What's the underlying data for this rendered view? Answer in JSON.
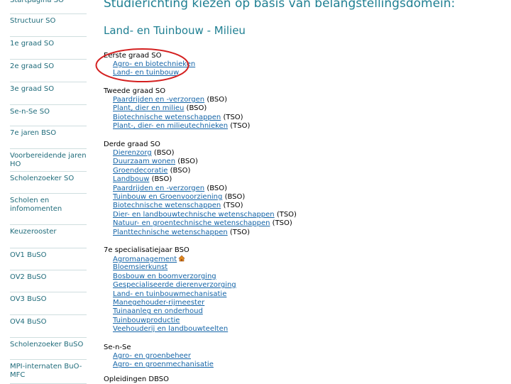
{
  "sidebar": {
    "items": [
      {
        "label": "Startpagina SO"
      },
      {
        "label": "Structuur SO"
      },
      {
        "label": "1e graad SO"
      },
      {
        "label": "2e graad SO"
      },
      {
        "label": "3e graad SO"
      },
      {
        "label": "Se-n-Se SO"
      },
      {
        "label": "7e jaren BSO"
      },
      {
        "label": "Voorbereidende jaren HO"
      },
      {
        "label": "Scholenzoeker SO"
      },
      {
        "label": "Scholen en infomomenten"
      },
      {
        "label": "Keuzerooster"
      },
      {
        "label": "OV1 BuSO"
      },
      {
        "label": "OV2 BuSO"
      },
      {
        "label": "OV3 BuSO"
      },
      {
        "label": "OV4 BuSO"
      },
      {
        "label": "Scholenzoeker BuSO"
      },
      {
        "label": "MPI-internaten BuO-MFC"
      }
    ]
  },
  "main": {
    "page_title": "Studierichting kiezen op basis van belangstellingsdomein:",
    "domain_title": "Land- en Tuinbouw - Milieu",
    "groups": [
      {
        "heading": "Eerste graad SO",
        "links": [
          {
            "label": "Agro- en biotechnieken",
            "suffix": ""
          },
          {
            "label": "Land- en tuinbouw",
            "suffix": ""
          }
        ]
      },
      {
        "heading": "Tweede graad SO",
        "links": [
          {
            "label": "Paardrijden en -verzorgen",
            "suffix": "(BSO)"
          },
          {
            "label": "Plant, dier en milieu",
            "suffix": "(BSO)"
          },
          {
            "label": "Biotechnische wetenschappen",
            "suffix": "(TSO)"
          },
          {
            "label": "Plant-, dier- en milieutechnieken",
            "suffix": "(TSO)"
          }
        ]
      },
      {
        "heading": "Derde graad SO",
        "links": [
          {
            "label": "Dierenzorg",
            "suffix": "(BSO)"
          },
          {
            "label": "Duurzaam wonen",
            "suffix": "(BSO)"
          },
          {
            "label": "Groendecoratie",
            "suffix": "(BSO)"
          },
          {
            "label": "Landbouw",
            "suffix": "(BSO)"
          },
          {
            "label": "Paardrijden en -verzorgen",
            "suffix": "(BSO)"
          },
          {
            "label": "Tuinbouw en Groenvoorziening",
            "suffix": "(BSO)"
          },
          {
            "label": "Biotechnische wetenschappen",
            "suffix": "(TSO)"
          },
          {
            "label": "Dier- en landbouwtechnische wetenschappen",
            "suffix": "(TSO)"
          },
          {
            "label": "Natuur- en groentechnische wetenschappen",
            "suffix": "(TSO)"
          },
          {
            "label": "Planttechnische wetenschappen",
            "suffix": "(TSO)"
          }
        ]
      },
      {
        "heading": "7e specialisatiejaar BSO",
        "links": [
          {
            "label": "Agromanagement",
            "suffix": "",
            "icon": "house-icon"
          },
          {
            "label": "Bloemsierkunst",
            "suffix": ""
          },
          {
            "label": "Bosbouw en boomverzorging",
            "suffix": ""
          },
          {
            "label": "Gespecialiseerde dierenverzorging",
            "suffix": ""
          },
          {
            "label": "Land- en tuinbouwmechanisatie",
            "suffix": ""
          },
          {
            "label": "Manegehouder-rijmeester",
            "suffix": ""
          },
          {
            "label": "Tuinaanleg en onderhoud",
            "suffix": ""
          },
          {
            "label": "Tuinbouwproductie",
            "suffix": ""
          },
          {
            "label": "Veehouderij en landbouwteelten",
            "suffix": ""
          }
        ]
      },
      {
        "heading": "Se-n-Se",
        "links": [
          {
            "label": "Agro- en groenbeheer",
            "suffix": ""
          },
          {
            "label": "Agro- en groenmechanisatie",
            "suffix": ""
          }
        ]
      },
      {
        "heading": "Opleidingen DBSO",
        "links": []
      }
    ]
  },
  "colors": {
    "accent": "#1f7f92",
    "sidebar_text": "#1f6b7a",
    "link": "#1565a8",
    "annotation": "#d42020"
  }
}
